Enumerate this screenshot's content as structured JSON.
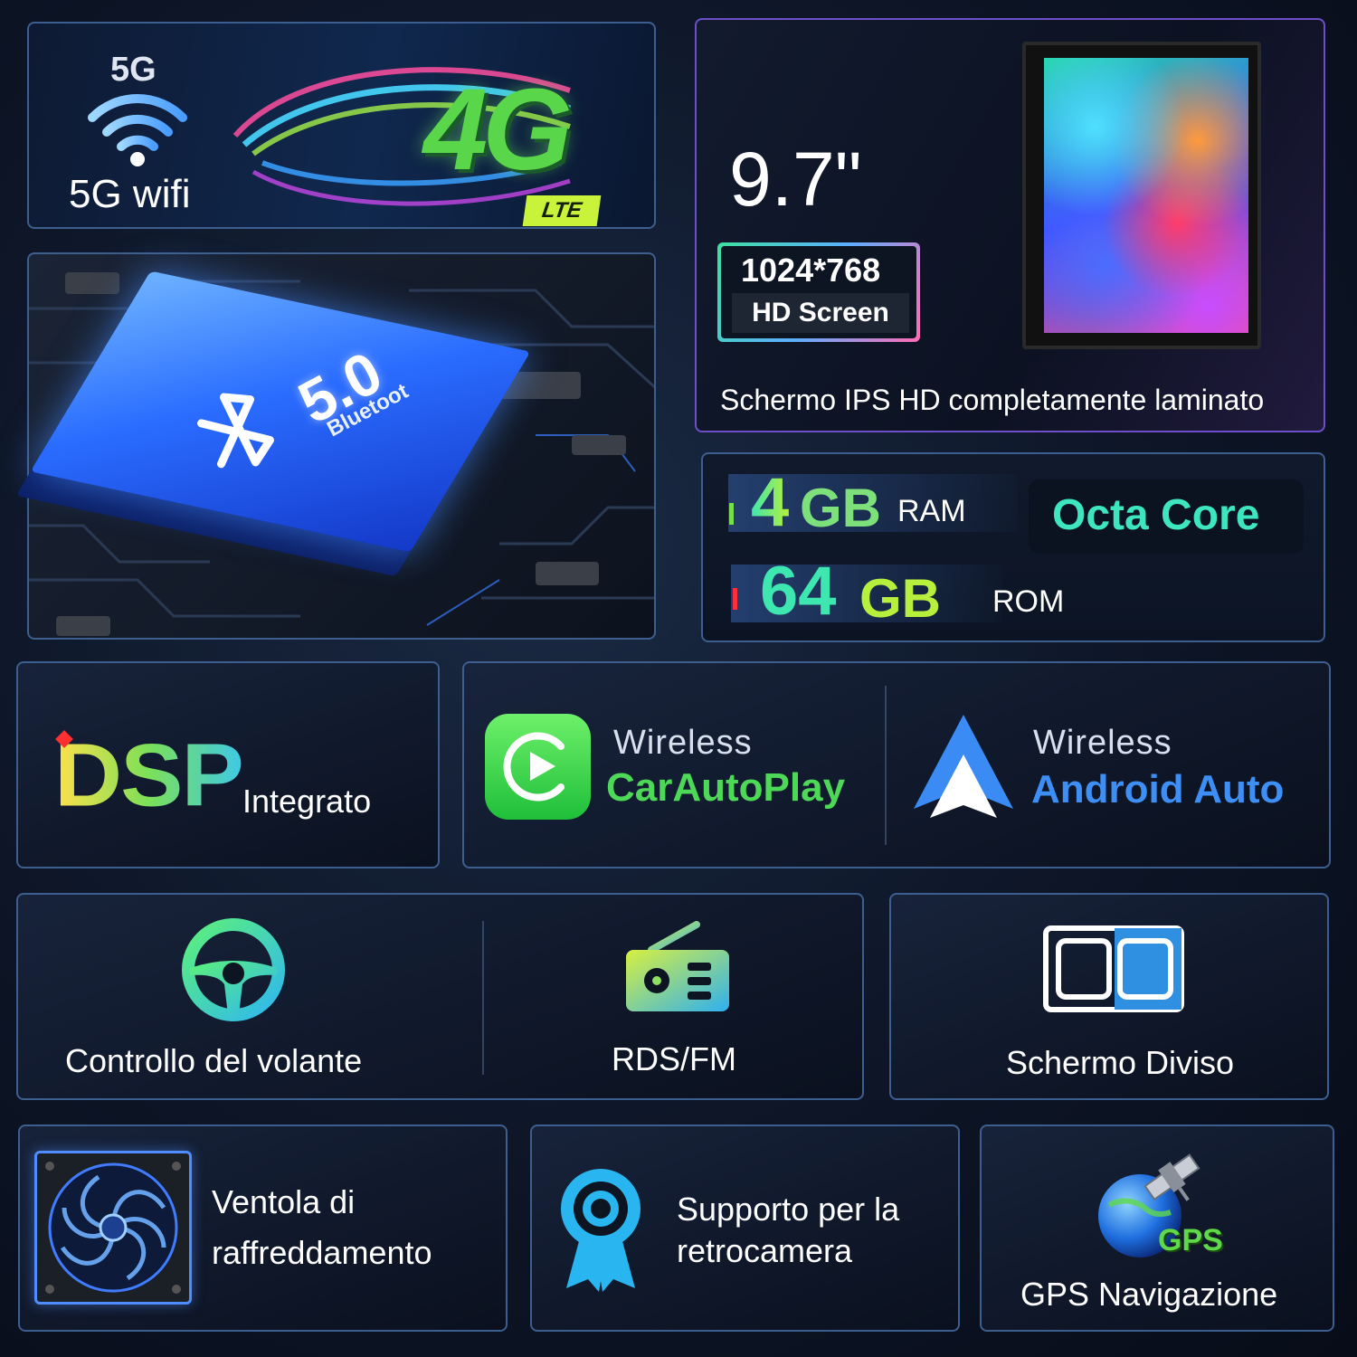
{
  "network": {
    "badge_5g": "5G",
    "wifi_label": "5G wifi",
    "badge_4g": "4G",
    "lte_tag": "LTE"
  },
  "bluetooth": {
    "version": "5.0",
    "word": "Bluetoot"
  },
  "screen": {
    "size": "9.7\"",
    "resolution": "1024*768",
    "resolution_tag": "HD Screen",
    "caption": "Schermo IPS HD completamente laminato"
  },
  "memory": {
    "ram_value": "4",
    "ram_unit": "GB",
    "ram_label": "RAM",
    "rom_value": "64",
    "rom_unit": "GB",
    "rom_label": "ROM",
    "cpu": "Octa Core"
  },
  "dsp": {
    "logo": "DSP",
    "label": "Integrato"
  },
  "carplay": {
    "prefix": "Wireless",
    "name": "CarAutoPlay"
  },
  "android_auto": {
    "prefix": "Wireless",
    "name": "Android Auto"
  },
  "features": {
    "steering": "Controllo del volante",
    "radio": "RDS/FM",
    "split_screen": "Schermo Diviso",
    "fan_line1": "Ventola di",
    "fan_line2": "raffreddamento",
    "camera_line1": "Supporto per la",
    "camera_line2": "retrocamera",
    "gps_tag": "GPS",
    "gps": "GPS Navigazione"
  },
  "icons": [
    "wifi-icon",
    "bluetooth-icon",
    "carplay-icon",
    "android-auto-icon",
    "steering-wheel-icon",
    "radio-icon",
    "split-screen-icon",
    "fan-icon",
    "camera-icon",
    "gps-satellite-icon"
  ],
  "colors": {
    "accent_green": "#4ed858",
    "accent_blue": "#3d8ef5",
    "accent_teal": "#3ee6c0",
    "card_border": "#3d5f8f"
  }
}
